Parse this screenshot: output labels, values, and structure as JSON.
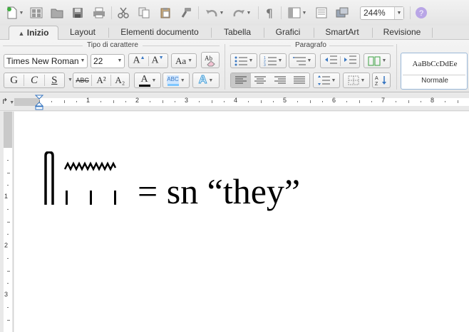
{
  "quick_access": {
    "zoom": "244%",
    "buttons": [
      "new-document",
      "templates",
      "open",
      "save",
      "print",
      "cut",
      "copy",
      "paste",
      "format-painter",
      "undo",
      "redo",
      "show-formatting",
      "view",
      "sidebar",
      "media",
      "help"
    ]
  },
  "tabs": [
    {
      "label": "Inizio",
      "active": true
    },
    {
      "label": "Layout",
      "active": false
    },
    {
      "label": "Elementi documento",
      "active": false
    },
    {
      "label": "Tabella",
      "active": false
    },
    {
      "label": "Grafici",
      "active": false
    },
    {
      "label": "SmartArt",
      "active": false
    },
    {
      "label": "Revisione",
      "active": false
    }
  ],
  "ribbon": {
    "font_group_title": "Tipo di carattere",
    "paragraph_group_title": "Paragrafo",
    "font_name": "Times New Roman",
    "font_size": "22",
    "bold_label": "G",
    "italic_label": "C",
    "underline_label": "S",
    "strike_label": "ABC",
    "superscript_label": "A²",
    "subscript_label": "A₂",
    "grow_label": "A",
    "shrink_label": "A",
    "case_label": "Aa",
    "font_color_label": "A",
    "highlight_label": "ABC",
    "effects_label": "A",
    "style_sample": "AaBbCcDdEe",
    "style_name": "Normale",
    "colors": {
      "font_color": "#000000",
      "highlight": "#7ec7ff",
      "accent": "#3a78c2"
    }
  },
  "ruler": {
    "numbers": [
      "1",
      "2",
      "3",
      "4",
      "5",
      "6",
      "7",
      "8"
    ]
  },
  "vruler": {
    "numbers": [
      "1",
      "2",
      "3"
    ]
  },
  "document": {
    "text": "= sn “they”"
  }
}
